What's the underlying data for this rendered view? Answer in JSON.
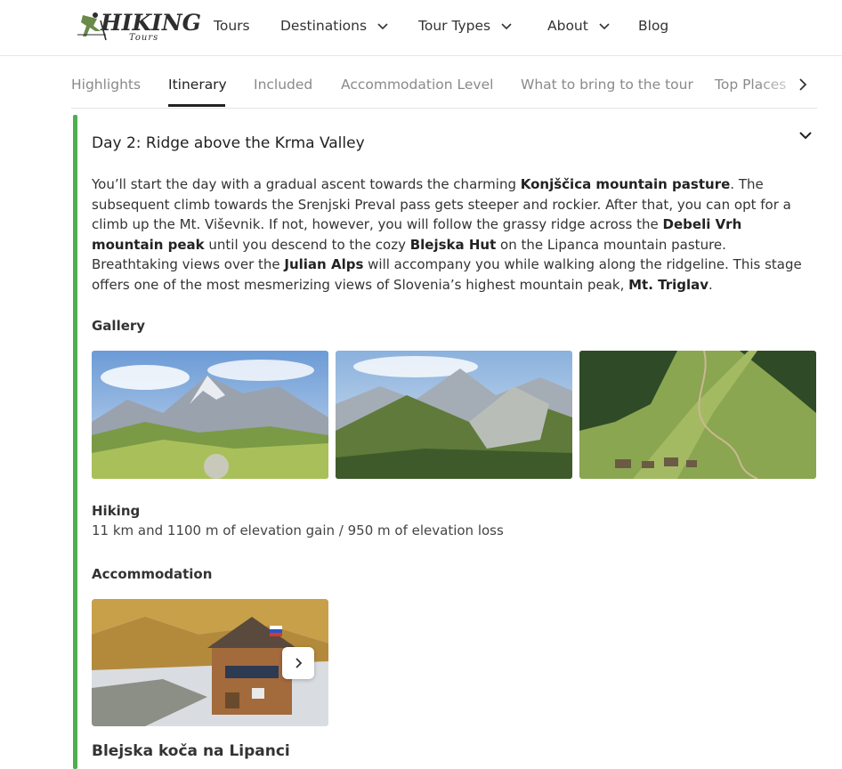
{
  "logo": {
    "main": "HIKING",
    "sub": "Tours"
  },
  "nav": {
    "tours": "Tours",
    "destinations": "Destinations",
    "tour_types": "Tour Types",
    "about": "About",
    "blog": "Blog"
  },
  "tabs": [
    {
      "label": "Highlights",
      "active": false
    },
    {
      "label": "Itinerary",
      "active": true
    },
    {
      "label": "Included",
      "active": false
    },
    {
      "label": "Accommodation Level",
      "active": false
    },
    {
      "label": "What to bring to the tour",
      "active": false
    },
    {
      "label": "Top Places",
      "active": false
    }
  ],
  "day": {
    "title": "Day 2: Ridge above the Krma Valley",
    "desc": {
      "p1": "You’ll start the day with a gradual ascent towards the charming ",
      "b1": "Konjščica mountain pasture",
      "p2": ". The subsequent climb towards the Srenjski Preval pass gets steeper and rockier. After that, you can opt for a climb up the Mt. Viševnik. If not, however, you will follow the grassy ridge across the ",
      "b2": "Debeli Vrh mountain peak",
      "p3": " until you descend to the cozy ",
      "b3": "Blejska Hut",
      "p4": " on the Lipanca mountain pasture. Breathtaking views over the ",
      "b4": "Julian Alps",
      "p5": " will accompany you while walking along the ridgeline. This stage offers one of the most mesmerizing views of Slovenia’s highest mountain peak, ",
      "b5": "Mt. Triglav",
      "p6": "."
    },
    "gallery_label": "Gallery",
    "hiking_label": "Hiking",
    "hiking_text": "11 km and 1100 m of elevation gain / 950 m of elevation loss",
    "accommodation_label": "Accommodation",
    "accommodation_name": "Blejska koča na Lipanci"
  },
  "colors": {
    "accent": "#4caf50",
    "text": "#333333",
    "muted": "#8a8a8a"
  },
  "icons": {
    "nav_dropdown": "chevron-down-icon",
    "tabs_next": "chevron-right-icon",
    "day_toggle": "chevron-down-icon",
    "carousel_next": "chevron-right-icon"
  }
}
